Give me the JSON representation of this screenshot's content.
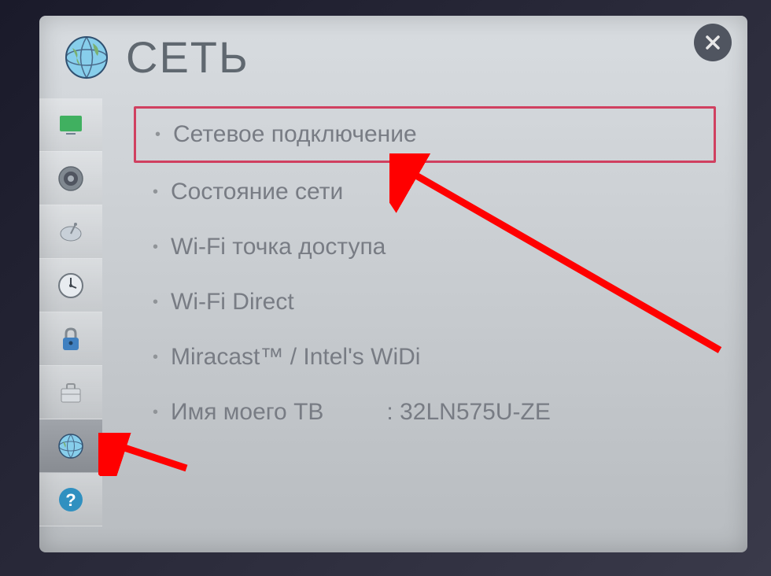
{
  "header": {
    "title": "СЕТЬ"
  },
  "sidebar": {
    "items": [
      {
        "name": "picture",
        "selected": false
      },
      {
        "name": "sound",
        "selected": false
      },
      {
        "name": "channel",
        "selected": false
      },
      {
        "name": "time",
        "selected": false
      },
      {
        "name": "lock",
        "selected": false
      },
      {
        "name": "option",
        "selected": false
      },
      {
        "name": "network",
        "selected": true
      },
      {
        "name": "support",
        "selected": false
      }
    ]
  },
  "menu": {
    "items": [
      {
        "label": "Сетевое подключение",
        "highlighted": true
      },
      {
        "label": "Состояние сети",
        "highlighted": false
      },
      {
        "label": "Wi-Fi точка доступа",
        "highlighted": false
      },
      {
        "label": "Wi-Fi Direct",
        "highlighted": false
      },
      {
        "label": "Miracast™ / Intel's WiDi",
        "highlighted": false
      },
      {
        "label": "Имя моего ТВ",
        "highlighted": false,
        "value": "32LN575U-ZE"
      }
    ]
  },
  "colors": {
    "highlight": "#d04060",
    "arrow": "#ff0000"
  }
}
